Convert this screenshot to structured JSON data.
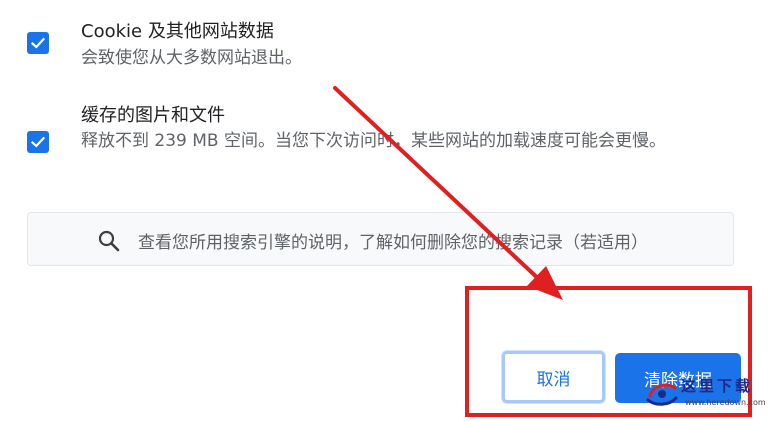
{
  "options": [
    {
      "checked": true,
      "title": "Cookie 及其他网站数据",
      "description": "会致使您从大多数网站退出。"
    },
    {
      "checked": true,
      "title": "缓存的图片和文件",
      "description": "释放不到 239 MB 空间。当您下次访问时，某些网站的加载速度可能会更慢。"
    }
  ],
  "info": {
    "icon": "search-icon",
    "text": "查看您所用搜索引擎的说明，了解如何删除您的搜索记录（若适用）"
  },
  "buttons": {
    "cancel_label": "取消",
    "clear_label": "清除数据"
  },
  "watermark": {
    "name": "这里下载",
    "url": "www.heredown.com"
  },
  "colors": {
    "accent": "#1a73e8",
    "annotation_red": "#e02020"
  }
}
